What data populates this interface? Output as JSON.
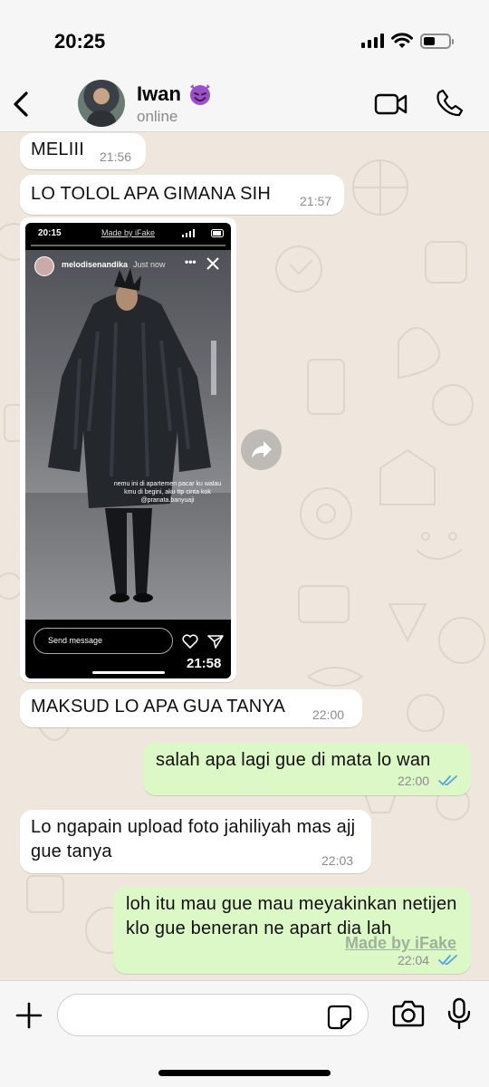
{
  "status_bar": {
    "time": "20:25"
  },
  "header": {
    "name": "Iwan",
    "emoji": "😈",
    "status": "online",
    "icons": {
      "back": "chevron-left-icon",
      "video": "video-camera-icon",
      "call": "phone-icon"
    }
  },
  "messages": [
    {
      "direction": "in",
      "text": "MELIII",
      "time": "21:56"
    },
    {
      "direction": "in",
      "text": "LO TOLOL APA GIMANA SIH",
      "time": "21:57"
    },
    {
      "direction": "in",
      "type": "story_screenshot",
      "time": "21:58",
      "story": {
        "status_time": "20:15",
        "made_by": "Made by iFake",
        "username": "melodisenandika",
        "posted": "Just now",
        "more": "•••",
        "caption": "nemu ini di apartemen pacar ku walau kmu di begini, aku ttp cinta kok @pranata.banyuaji",
        "send_placeholder": "Send message"
      }
    },
    {
      "direction": "in",
      "text": "MAKSUD LO APA GUA TANYA",
      "time": "22:00"
    },
    {
      "direction": "out",
      "text": "salah apa lagi gue di mata lo wan",
      "time": "22:00",
      "read": true
    },
    {
      "direction": "in",
      "text": "Lo ngapain upload foto jahiliyah mas ajj gue tanya",
      "time": "22:03"
    },
    {
      "direction": "out",
      "text": "loh itu mau gue mau meyakinkan netijen klo gue beneran ne apart dia lah",
      "time": "22:04",
      "read": true
    }
  ],
  "watermark": "Made by iFake",
  "input_bar": {
    "placeholder": "",
    "icons": {
      "attach": "plus-icon",
      "sticker": "sticker-icon",
      "camera": "camera-icon",
      "mic": "microphone-icon"
    }
  },
  "colors": {
    "incoming": "#ffffff",
    "outgoing": "#dcf8c6",
    "chat_bg": "#efe7dd",
    "read_ticks": "#4fa6e0"
  }
}
